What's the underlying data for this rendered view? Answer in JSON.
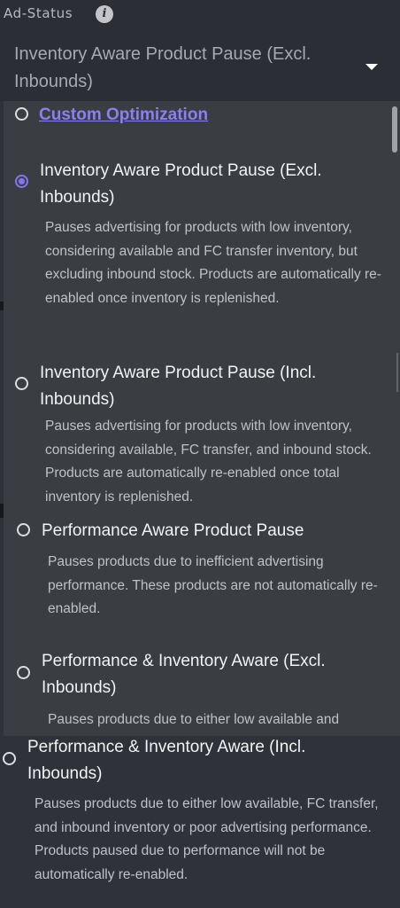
{
  "field": {
    "label": "Ad-Status",
    "info_icon": "info-icon",
    "selected_value": "Inventory Aware Product Pause (Excl. Inbounds)",
    "caret_icon": "chevron-down-icon"
  },
  "colors": {
    "accent": "#8476f0",
    "link": "#8a7ff5",
    "panel_bg": "#3a3e43",
    "header_bg": "#2b2f35"
  },
  "options": [
    {
      "title": "Custom Optimization",
      "selected": false,
      "description": ""
    },
    {
      "title": "Inventory Aware Product Pause (Excl. Inbounds)",
      "selected": true,
      "description": "Pauses advertising for products with low inventory, considering available and FC transfer inventory, but excluding inbound stock. Products are automatically re-enabled once inventory is replenished."
    },
    {
      "title": "Inventory Aware Product Pause (Incl. Inbounds)",
      "selected": false,
      "description": "Pauses advertising for products with low inventory, considering available, FC transfer, and inbound stock. Products are automatically re-enabled once total inventory is replenished."
    },
    {
      "title": "Performance Aware Product Pause",
      "selected": false,
      "description": "Pauses products due to inefficient advertising performance. These products are not automatically re-enabled."
    },
    {
      "title": "Performance & Inventory Aware (Excl. Inbounds)",
      "selected": false,
      "description": "Pauses products due to either low available and"
    },
    {
      "title": "Performance & Inventory Aware (Incl. Inbounds)",
      "selected": false,
      "description": "Pauses products due to either low available, FC transfer, and inbound inventory or poor advertising performance. Products paused due to performance will not be automatically re-enabled."
    }
  ]
}
